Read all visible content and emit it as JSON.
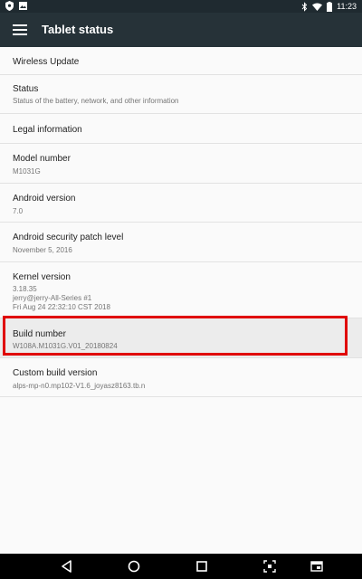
{
  "status_bar": {
    "time": "11:23",
    "icons": [
      "shield-icon",
      "image-icon",
      "bluetooth-icon",
      "wifi-icon",
      "battery-icon"
    ]
  },
  "toolbar": {
    "title": "Tablet status",
    "menu_icon": "hamburger-menu-icon"
  },
  "items": [
    {
      "title": "Wireless Update",
      "subtitle": ""
    },
    {
      "title": "Status",
      "subtitle": "Status of the battery, network, and other information"
    },
    {
      "title": "Legal information",
      "subtitle": ""
    },
    {
      "title": "Model number",
      "subtitle": "M1031G"
    },
    {
      "title": "Android version",
      "subtitle": "7.0"
    },
    {
      "title": "Android security patch level",
      "subtitle": "November 5, 2016"
    },
    {
      "title": "Kernel version",
      "subtitle_lines": [
        "3.18.35",
        "jerry@jerry-All-Series #1",
        "Fri Aug 24 22:32:10 CST 2018"
      ]
    },
    {
      "title": "Build number",
      "subtitle": "W108A.M1031G.V01_20180824"
    },
    {
      "title": "Custom build version",
      "subtitle": "alps-mp-n0.mp102-V1.6_joyasz8163.tb.n"
    }
  ],
  "highlight_color": "#e00000",
  "nav_bar": {
    "buttons": [
      "back-icon",
      "home-icon",
      "recents-icon",
      "screenshot-icon",
      "window-icon"
    ]
  }
}
